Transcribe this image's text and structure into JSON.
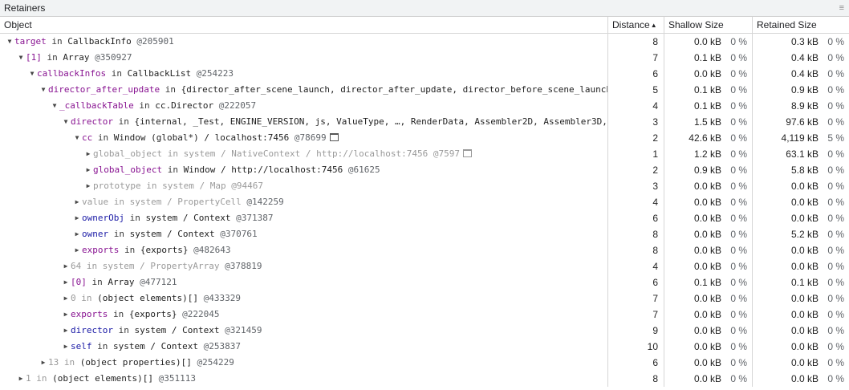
{
  "panel": {
    "title": "Retainers",
    "menu_glyph": "≡"
  },
  "columns": {
    "object": "Object",
    "distance": "Distance",
    "shallow": "Shallow Size",
    "retained": "Retained Size",
    "sort_arrow": "▲"
  },
  "rows": [
    {
      "indent": 0,
      "expanded": true,
      "name": "target",
      "name_style": "prop",
      "conn": " in ",
      "parts": [
        {
          "t": "CallbackInfo ",
          "s": "cls"
        }
      ],
      "id": "@205901",
      "dist": "8",
      "shallow": "0.0 kB",
      "shallow_pct": "0 %",
      "retained": "0.3 kB",
      "retained_pct": "0 %"
    },
    {
      "indent": 1,
      "expanded": true,
      "name": "[1]",
      "name_style": "prop",
      "conn": " in ",
      "parts": [
        {
          "t": "Array ",
          "s": "cls"
        }
      ],
      "id": "@350927",
      "dist": "7",
      "shallow": "0.1 kB",
      "shallow_pct": "0 %",
      "retained": "0.4 kB",
      "retained_pct": "0 %"
    },
    {
      "indent": 2,
      "expanded": true,
      "name": "callbackInfos",
      "name_style": "prop",
      "conn": " in ",
      "parts": [
        {
          "t": "CallbackList ",
          "s": "cls"
        }
      ],
      "id": "@254223",
      "dist": "6",
      "shallow": "0.0 kB",
      "shallow_pct": "0 %",
      "retained": "0.4 kB",
      "retained_pct": "0 %"
    },
    {
      "indent": 3,
      "expanded": true,
      "name": "director_after_update",
      "name_style": "prop",
      "conn": " in ",
      "parts": [
        {
          "t": "{director_after_scene_launch, director_after_update, director_before_scene_launch, …}",
          "s": "cls"
        }
      ],
      "id": "",
      "dist": "5",
      "shallow": "0.1 kB",
      "shallow_pct": "0 %",
      "retained": "0.9 kB",
      "retained_pct": "0 %"
    },
    {
      "indent": 4,
      "expanded": true,
      "name": "_callbackTable",
      "name_style": "prop",
      "conn": " in ",
      "parts": [
        {
          "t": "cc.Director ",
          "s": "cls"
        }
      ],
      "id": "@222057",
      "dist": "4",
      "shallow": "0.1 kB",
      "shallow_pct": "0 %",
      "retained": "8.9 kB",
      "retained_pct": "0 %"
    },
    {
      "indent": 5,
      "expanded": true,
      "name": "director",
      "name_style": "prop",
      "conn": " in ",
      "parts": [
        {
          "t": "{internal, _Test, ENGINE_VERSION, js, ValueType, …, RenderData, Assembler2D, Assembler3D, …}",
          "s": "cls"
        }
      ],
      "id": "",
      "dist": "3",
      "shallow": "1.5 kB",
      "shallow_pct": "0 %",
      "retained": "97.6 kB",
      "retained_pct": "0 %"
    },
    {
      "indent": 6,
      "expanded": true,
      "name": "cc",
      "name_style": "prop",
      "conn": " in ",
      "parts": [
        {
          "t": "Window (global*) / localhost:7456 ",
          "s": "cls"
        }
      ],
      "id": "@78699",
      "icon": true,
      "dist": "2",
      "shallow": "42.6 kB",
      "shallow_pct": "0 %",
      "retained": "4,119 kB",
      "retained_pct": "5 %"
    },
    {
      "indent": 7,
      "expanded": false,
      "dim": true,
      "name": "global_object",
      "name_style": "prop",
      "conn": " in ",
      "parts": [
        {
          "t": "system / NativeContext / http://localhost:7456 ",
          "s": "cls"
        }
      ],
      "id": "@7597",
      "icon": true,
      "dist": "1",
      "shallow": "1.2 kB",
      "shallow_pct": "0 %",
      "retained": "63.1 kB",
      "retained_pct": "0 %"
    },
    {
      "indent": 7,
      "expanded": false,
      "name": "global_object",
      "name_style": "prop",
      "conn": " in ",
      "parts": [
        {
          "t": "Window / http://localhost:7456 ",
          "s": "cls"
        }
      ],
      "id": "@61625",
      "dist": "2",
      "shallow": "0.9 kB",
      "shallow_pct": "0 %",
      "retained": "5.8 kB",
      "retained_pct": "0 %"
    },
    {
      "indent": 7,
      "expanded": false,
      "dim": true,
      "name": "prototype",
      "name_style": "prop",
      "conn": " in ",
      "parts": [
        {
          "t": "system / Map ",
          "s": "cls"
        }
      ],
      "id": "@94467",
      "dist": "3",
      "shallow": "0.0 kB",
      "shallow_pct": "0 %",
      "retained": "0.0 kB",
      "retained_pct": "0 %"
    },
    {
      "indent": 6,
      "expanded": false,
      "name": "value",
      "name_style": "prop dimname",
      "conn": " in ",
      "parts": [
        {
          "t": "system / PropertyCell ",
          "s": "sys"
        }
      ],
      "id": "@142259",
      "dist": "4",
      "shallow": "0.0 kB",
      "shallow_pct": "0 %",
      "retained": "0.0 kB",
      "retained_pct": "0 %"
    },
    {
      "indent": 6,
      "expanded": false,
      "name": "ownerObj",
      "name_style": "prop blue",
      "conn": " in ",
      "parts": [
        {
          "t": "system / Context ",
          "s": "cls"
        }
      ],
      "id": "@371387",
      "dist": "6",
      "shallow": "0.0 kB",
      "shallow_pct": "0 %",
      "retained": "0.0 kB",
      "retained_pct": "0 %"
    },
    {
      "indent": 6,
      "expanded": false,
      "name": "owner",
      "name_style": "prop blue",
      "conn": " in ",
      "parts": [
        {
          "t": "system / Context ",
          "s": "cls"
        }
      ],
      "id": "@370761",
      "dist": "8",
      "shallow": "0.0 kB",
      "shallow_pct": "0 %",
      "retained": "5.2 kB",
      "retained_pct": "0 %"
    },
    {
      "indent": 6,
      "expanded": false,
      "name": "exports",
      "name_style": "prop",
      "conn": " in ",
      "parts": [
        {
          "t": "{exports} ",
          "s": "cls"
        }
      ],
      "id": "@482643",
      "dist": "8",
      "shallow": "0.0 kB",
      "shallow_pct": "0 %",
      "retained": "0.0 kB",
      "retained_pct": "0 %"
    },
    {
      "indent": 5,
      "expanded": false,
      "name": "64",
      "name_style": "prop dimname",
      "conn": " in ",
      "parts": [
        {
          "t": "system / PropertyArray ",
          "s": "sys"
        }
      ],
      "id": "@378819",
      "dist": "4",
      "shallow": "0.0 kB",
      "shallow_pct": "0 %",
      "retained": "0.0 kB",
      "retained_pct": "0 %"
    },
    {
      "indent": 5,
      "expanded": false,
      "name": "[0]",
      "name_style": "prop",
      "conn": " in ",
      "parts": [
        {
          "t": "Array ",
          "s": "cls"
        }
      ],
      "id": "@477121",
      "dist": "6",
      "shallow": "0.1 kB",
      "shallow_pct": "0 %",
      "retained": "0.1 kB",
      "retained_pct": "0 %"
    },
    {
      "indent": 5,
      "expanded": false,
      "name": "0",
      "name_style": "prop dimname",
      "conn": " in ",
      "parts": [
        {
          "t": "(object elements)[] ",
          "s": "cls"
        }
      ],
      "id": "@433329",
      "dist": "7",
      "shallow": "0.0 kB",
      "shallow_pct": "0 %",
      "retained": "0.0 kB",
      "retained_pct": "0 %"
    },
    {
      "indent": 5,
      "expanded": false,
      "name": "exports",
      "name_style": "prop",
      "conn": " in ",
      "parts": [
        {
          "t": "{exports} ",
          "s": "cls"
        }
      ],
      "id": "@222045",
      "dist": "7",
      "shallow": "0.0 kB",
      "shallow_pct": "0 %",
      "retained": "0.0 kB",
      "retained_pct": "0 %"
    },
    {
      "indent": 5,
      "expanded": false,
      "name": "director",
      "name_style": "prop blue",
      "conn": " in ",
      "parts": [
        {
          "t": "system / Context ",
          "s": "cls"
        }
      ],
      "id": "@321459",
      "dist": "9",
      "shallow": "0.0 kB",
      "shallow_pct": "0 %",
      "retained": "0.0 kB",
      "retained_pct": "0 %"
    },
    {
      "indent": 5,
      "expanded": false,
      "name": "self",
      "name_style": "prop blue",
      "conn": " in ",
      "parts": [
        {
          "t": "system / Context ",
          "s": "cls"
        }
      ],
      "id": "@253837",
      "dist": "10",
      "shallow": "0.0 kB",
      "shallow_pct": "0 %",
      "retained": "0.0 kB",
      "retained_pct": "0 %"
    },
    {
      "indent": 3,
      "expanded": false,
      "name": "13",
      "name_style": "prop dimname",
      "conn": " in ",
      "parts": [
        {
          "t": "(object properties)[] ",
          "s": "cls"
        }
      ],
      "id": "@254229",
      "dist": "6",
      "shallow": "0.0 kB",
      "shallow_pct": "0 %",
      "retained": "0.0 kB",
      "retained_pct": "0 %"
    },
    {
      "indent": 1,
      "expanded": false,
      "name": "1",
      "name_style": "prop dimname",
      "conn": " in ",
      "parts": [
        {
          "t": "(object elements)[] ",
          "s": "cls"
        }
      ],
      "id": "@351113",
      "dist": "8",
      "shallow": "0.0 kB",
      "shallow_pct": "0 %",
      "retained": "0.0 kB",
      "retained_pct": "0 %"
    }
  ],
  "glyphs": {
    "expanded": "▼",
    "collapsed": "▶",
    "window_icon": "window-icon"
  }
}
